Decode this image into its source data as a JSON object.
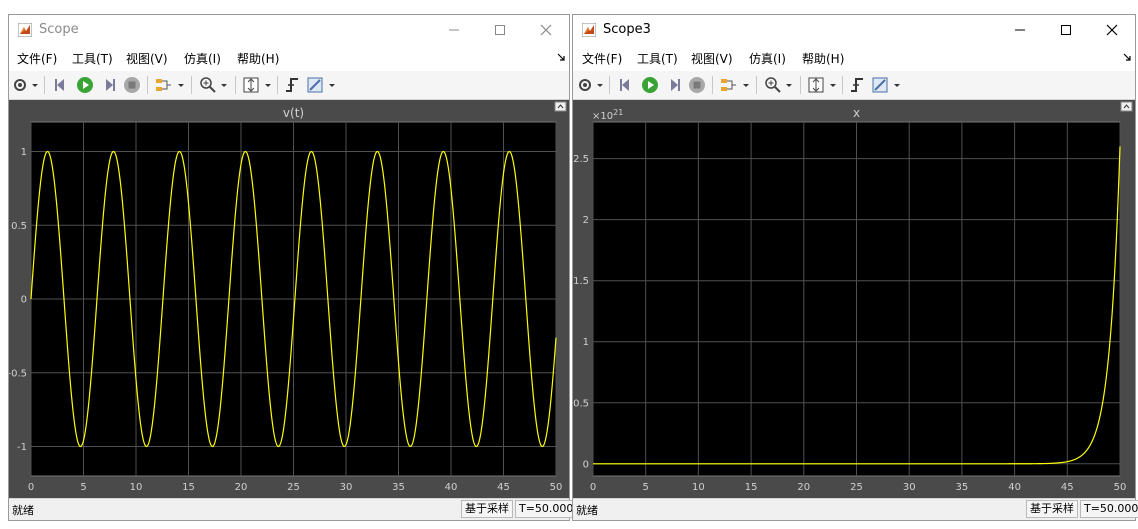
{
  "windows": [
    {
      "title": "Scope",
      "menu": [
        "文件(F)",
        "工具(T)",
        "视图(V)",
        "仿真(I)",
        "帮助(H)"
      ],
      "status": {
        "text": "就绪",
        "mode": "基于采样",
        "time": "T=50.000"
      }
    },
    {
      "title": "Scope3",
      "menu": [
        "文件(F)",
        "工具(T)",
        "视图(V)",
        "仿真(I)",
        "帮助(H)"
      ],
      "status": {
        "text": "就绪",
        "mode": "基于采样",
        "time": "T=50.000"
      }
    }
  ],
  "toolbar_icons": [
    "settings-icon",
    "dropdown-icon",
    "step-back-icon",
    "run-icon",
    "step-forward-icon",
    "stop-icon",
    "signal-select-icon",
    "dropdown-icon",
    "zoom-in-icon",
    "dropdown-icon",
    "autoscale-icon",
    "dropdown-icon",
    "triggers-icon",
    "measurements-icon",
    "dropdown-icon"
  ],
  "colors": {
    "trace": "#ffff00",
    "plot_bg": "#000000",
    "frame": "#4a4a4a",
    "grid": "#505050",
    "text": "#d0d0d0"
  },
  "chart_data": [
    {
      "type": "line",
      "title": "v(t)",
      "xlim": [
        0,
        50
      ],
      "ylim": [
        -1.2,
        1.2
      ],
      "xticks": [
        0,
        5,
        10,
        15,
        20,
        25,
        30,
        35,
        40,
        45,
        50
      ],
      "yticks": [
        1,
        0.5,
        0,
        -0.5,
        -1
      ],
      "ytick_labels": [
        "1",
        "0.5",
        "0",
        "-0.5",
        "-1"
      ],
      "series": [
        {
          "function": "sin(t)",
          "x_range": [
            0,
            50
          ]
        }
      ],
      "grid": true,
      "exponent_label": ""
    },
    {
      "type": "line",
      "title": "x",
      "xlim": [
        0,
        50
      ],
      "ylim": [
        -0.1,
        2.8
      ],
      "xticks": [
        0,
        5,
        10,
        15,
        20,
        25,
        30,
        35,
        40,
        45,
        50
      ],
      "yticks": [
        2.5,
        2,
        1.5,
        1,
        0.5,
        0
      ],
      "ytick_labels": [
        "2.5",
        "2",
        "1.5",
        "1",
        "0.5",
        "0"
      ],
      "exponent_label": "×10",
      "exponent_power": "21",
      "series": [
        {
          "function": "exp(t)/2 scaled 1e21",
          "x_range": [
            0,
            50
          ],
          "y_end": 2.6
        }
      ],
      "grid": true
    }
  ]
}
